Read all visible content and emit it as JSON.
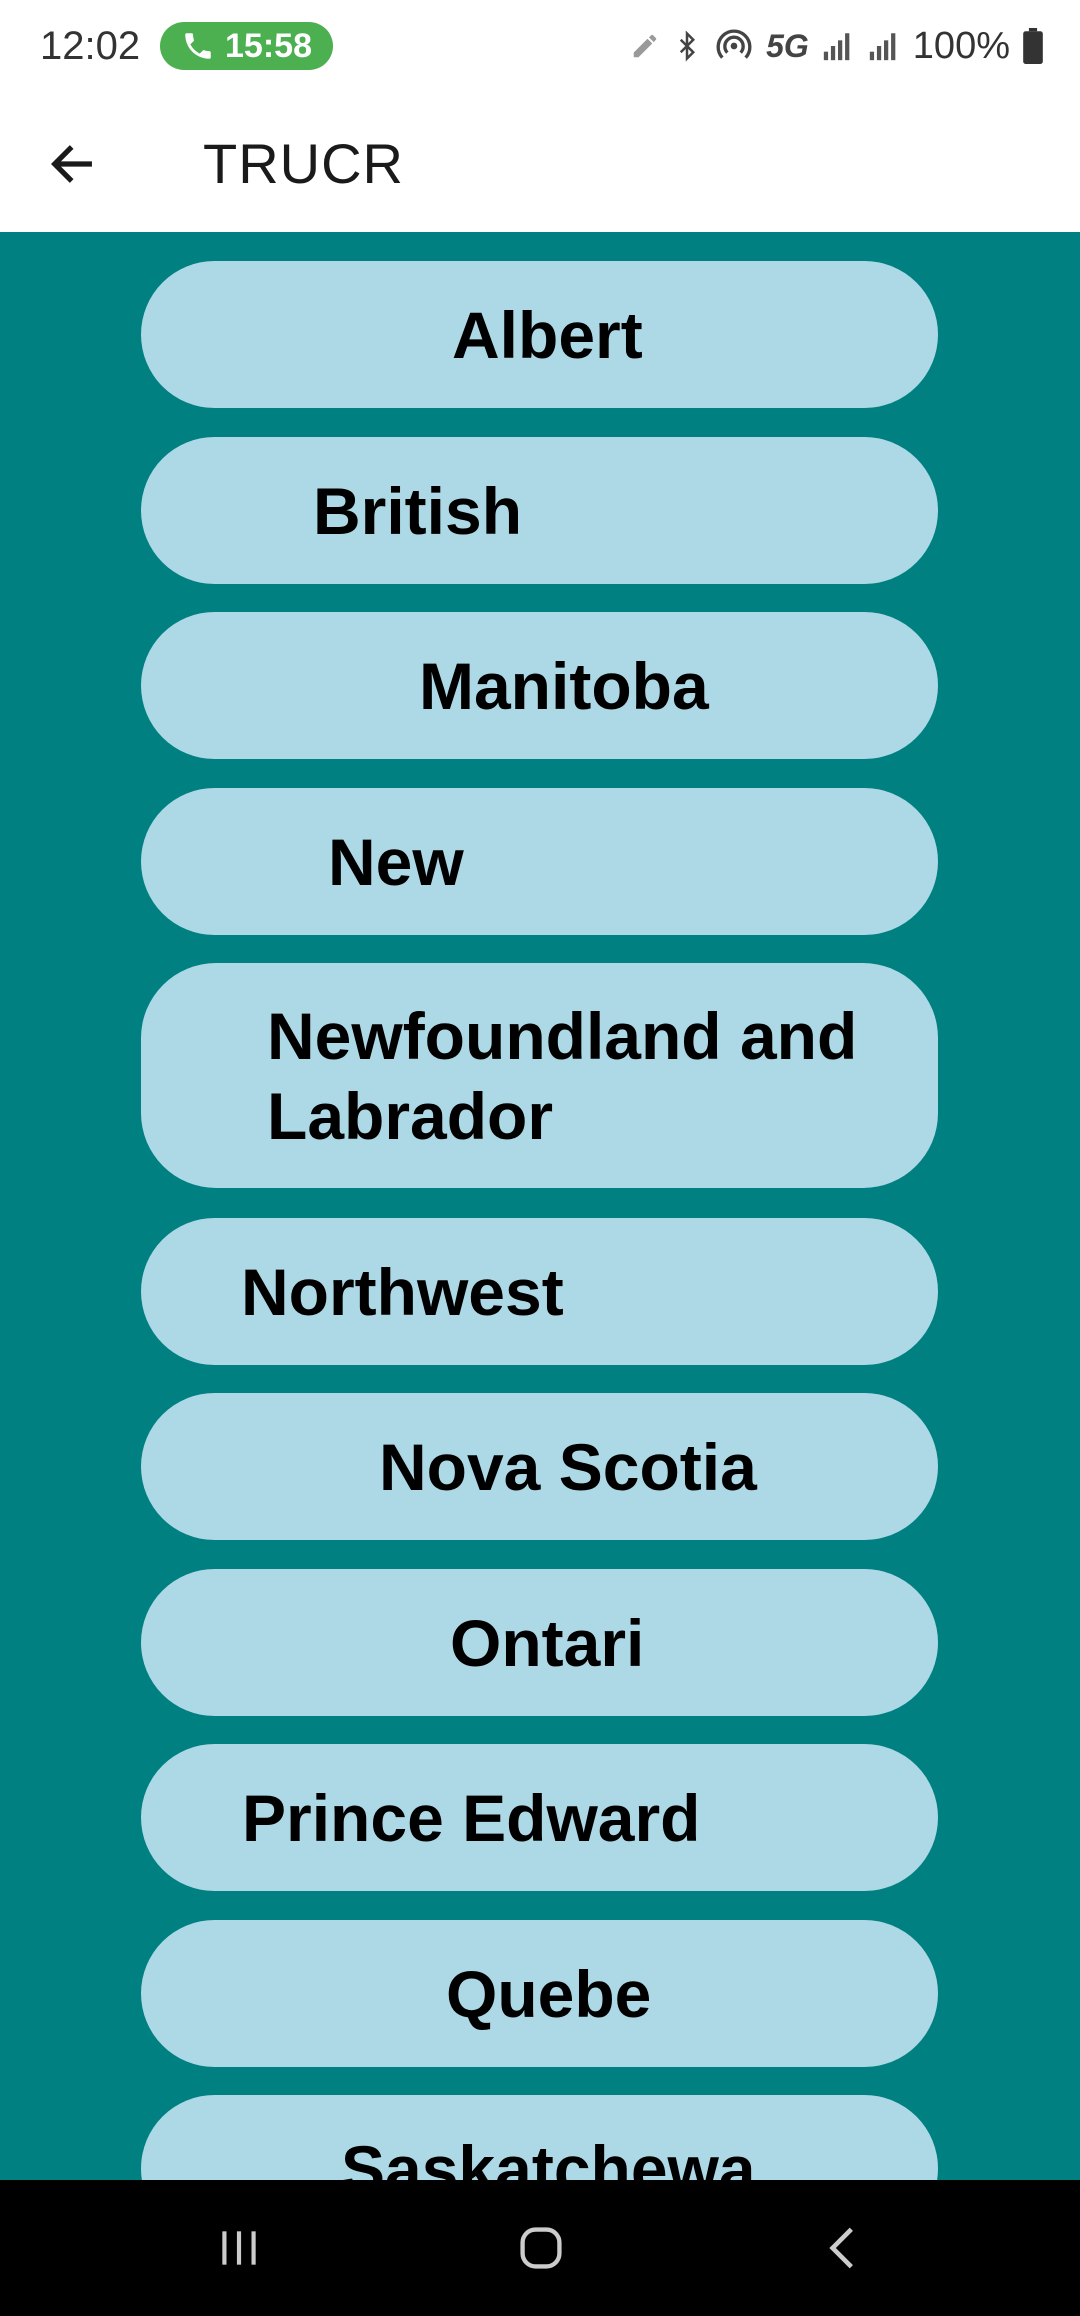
{
  "status_bar": {
    "time": "12:02",
    "call_timer": "15:58",
    "network": "5G",
    "battery": "100%"
  },
  "app_bar": {
    "title": "TRUCR"
  },
  "provinces": [
    {
      "label": "Albert"
    },
    {
      "label": "British"
    },
    {
      "label": "Manitoba"
    },
    {
      "label": "New"
    },
    {
      "label": "Newfoundland and Labrador"
    },
    {
      "label": "Northwest"
    },
    {
      "label": "Nova Scotia"
    },
    {
      "label": "Ontari"
    },
    {
      "label": "Prince Edward"
    },
    {
      "label": "Quebe"
    },
    {
      "label": "Saskatchewa"
    }
  ],
  "colors": {
    "content_background": "#008080",
    "button_background": "#add8e6",
    "call_pill": "#4caf50",
    "nav_bar": "#000000"
  },
  "icons": {
    "back": "arrow-left-icon",
    "recents": "recents-icon",
    "home": "home-icon",
    "nav_back": "chevron-left-icon"
  }
}
